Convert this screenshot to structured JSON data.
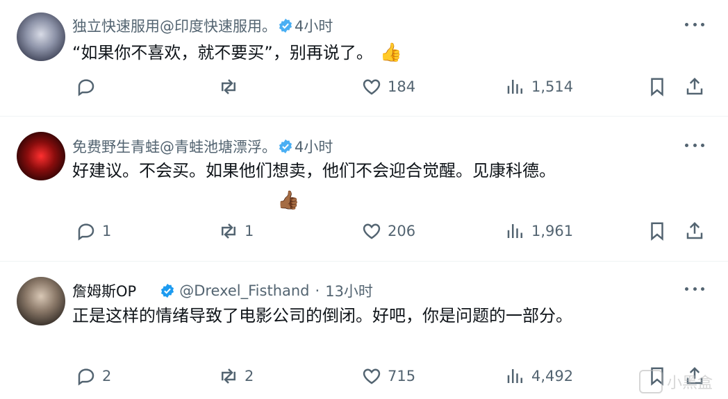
{
  "tweets": [
    {
      "name": "独立快速服用@印度快速服用。",
      "verified": true,
      "time": "4小时",
      "text": "“如果你不喜欢，就不要买”，别再说了。",
      "emoji": "👍",
      "replies": "",
      "retweets": "",
      "likes": "184",
      "views": "1,514"
    },
    {
      "name": "免费野生青蛙@青蛙池塘漂浮。",
      "verified": true,
      "time": "4小时",
      "text": "好建议。不会买。如果他们想卖，他们不会迎合觉醒。见康科德。",
      "emoji": "👍🏾",
      "replies": "1",
      "retweets": "1",
      "likes": "206",
      "views": "1,961"
    },
    {
      "name": "詹姆斯OP",
      "verified": true,
      "handle": "@Drexel_Fisthand",
      "separator": "·",
      "time": "13小时",
      "text": "正是这样的情绪导致了电影公司的倒闭。好吧，你是问题的一部分。",
      "replies": "2",
      "retweets": "2",
      "likes": "715",
      "views": "4,492"
    }
  ],
  "watermark": "小黑盒",
  "colors": {
    "secondary": "#536471",
    "primary": "#0f1419",
    "verified": "#1d9bf0"
  }
}
